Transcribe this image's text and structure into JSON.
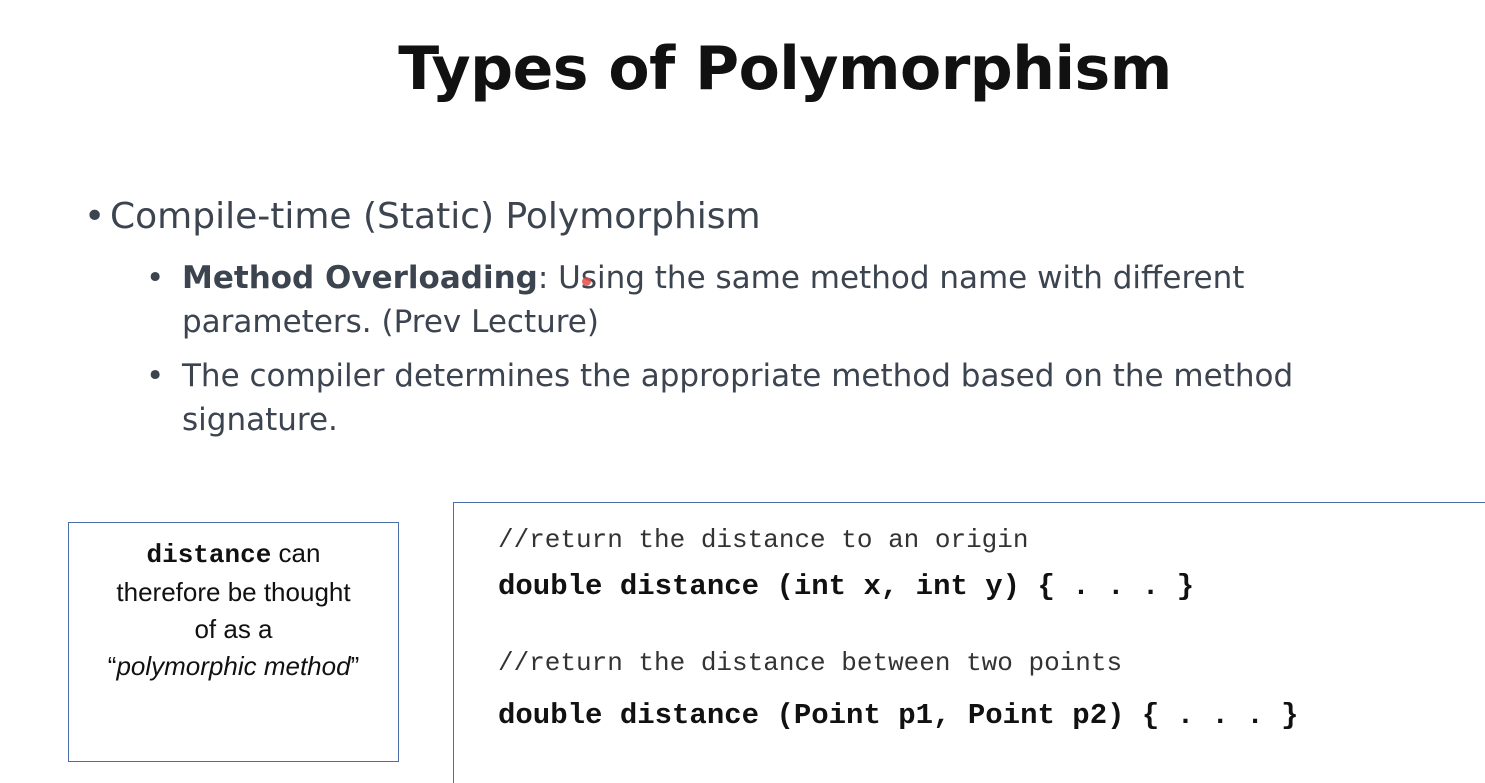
{
  "slide": {
    "title": "Types of Polymorphism",
    "bullet_main": "Compile-time (Static) Polymorphism",
    "sub_bullets": [
      {
        "bold": "Method Overloading",
        "rest": ": Using the same method name with different parameters. (Prev Lecture)"
      },
      {
        "bold": "",
        "rest": "The compiler determines the appropriate method based on the method signature."
      }
    ],
    "bullet_glyph": "•"
  },
  "note_box": {
    "keyword": "distance",
    "line1_rest": " can",
    "line2": "therefore be thought",
    "line3": "of as a",
    "open_quote": "“",
    "phrase": "polymorphic method",
    "close_quote": "”"
  },
  "code_box": {
    "comment1": "//return the distance to an origin",
    "code1": "double distance (int x, int y) { . . . }",
    "comment2": "//return the distance between two points",
    "code2": "double distance (Point p1, Point p2) { . . . }"
  },
  "colors": {
    "title": "#111111",
    "body_text": "#3c4450",
    "box_border": "#4a6ea8",
    "cursor": "#e0504a"
  }
}
